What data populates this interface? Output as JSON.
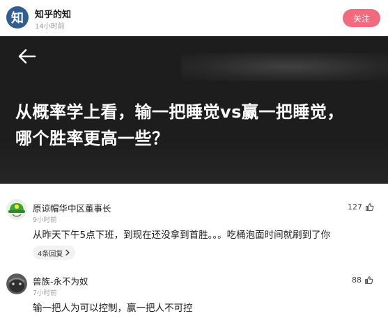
{
  "author": {
    "avatar_char": "知",
    "name": "知乎的知",
    "time": "14小时前",
    "follow_label": "关注"
  },
  "question": {
    "title_line1": "从概率学上看，输一把睡觉vs赢一把睡觉，",
    "title_line2": "哪个胜率更高一些？"
  },
  "comments": [
    {
      "name": "原谅帽华中区董事长",
      "time": "9小时前",
      "likes": "127",
      "text": "从昨天下午5点下班，到现在还没拿到首胜。。。吃桶泡面时间就刷到了你",
      "reply_label": "4条回复"
    },
    {
      "name": "兽族-永不为奴",
      "time": "7小时前",
      "likes": "88",
      "text": "输一把人为可以控制，赢一把人不可控"
    }
  ],
  "icons": {
    "back": "arrow-left-icon",
    "like": "thumbs-up-icon",
    "chevron": "chevron-right-icon"
  },
  "colors": {
    "follow_button": "#f26a7d",
    "hero_background": "#1d1d1d",
    "author_avatar": "#2f5f92"
  }
}
